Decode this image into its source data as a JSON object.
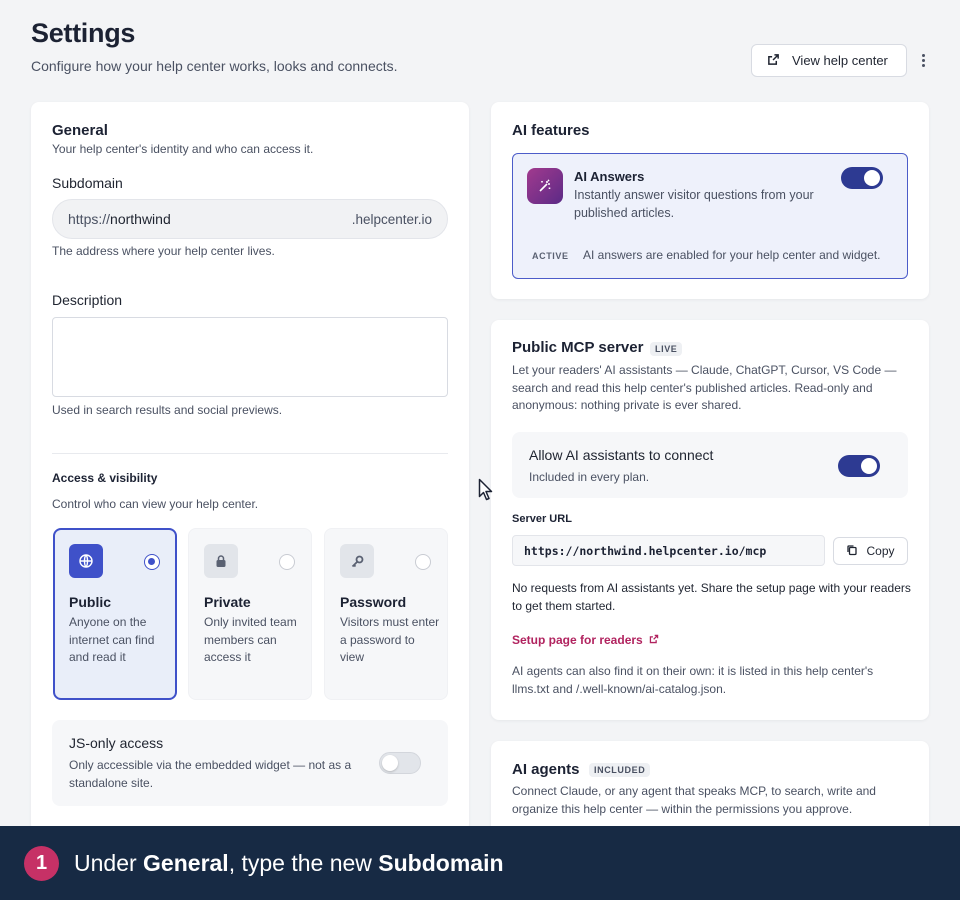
{
  "header": {
    "title": "Settings",
    "subtitle": "Configure how your help center works, looks and connects.",
    "view_button": "View help center",
    "view_icon": "external-link-icon",
    "more_icon": "more-vertical-icon"
  },
  "general": {
    "title": "General",
    "subtitle": "Your help center's identity and who can access it.",
    "subdomain_label": "Subdomain",
    "subdomain_prefix": "https://",
    "subdomain_value": "northwind",
    "subdomain_suffix": ".helpcenter.io",
    "subdomain_help": "The address where your help center lives.",
    "description_label": "Description",
    "description_value": "",
    "description_help": "Used in search results and social previews.",
    "access_title": "Access & visibility",
    "access_subtitle": "Control who can view your help center.",
    "options": [
      {
        "title": "Public",
        "desc": "Anyone on the internet can find and read it",
        "icon": "globe-icon",
        "selected": true
      },
      {
        "title": "Private",
        "desc": "Only invited team members can access it",
        "icon": "lock-icon",
        "selected": false
      },
      {
        "title": "Password",
        "desc": "Visitors must enter a password to view",
        "icon": "key-icon",
        "selected": false
      }
    ],
    "js_title": "JS-only access",
    "js_desc": "Only accessible via the embedded widget — not as a standalone site.",
    "js_enabled": false
  },
  "ai_features": {
    "title": "AI features",
    "answers_title": "AI Answers",
    "answers_desc": "Instantly answer visitor questions from your published articles.",
    "answers_icon": "magic-wand-icon",
    "answers_enabled": true,
    "status_badge": "ACTIVE",
    "status_text": "AI answers are enabled for your help center and widget."
  },
  "mcp": {
    "title": "Public MCP server",
    "badge": "LIVE",
    "desc": "Let your readers' AI assistants — Claude, ChatGPT, Cursor, VS Code — search and read this help center's published articles. Read-only and anonymous: nothing private is ever shared.",
    "allow_title": "Allow AI assistants to connect",
    "allow_sub": "Included in every plan.",
    "allow_enabled": true,
    "url_label": "Server URL",
    "url": "https://northwind.helpcenter.io/mcp",
    "copy_label": "Copy",
    "copy_icon": "copy-icon",
    "no_requests": "No requests from AI assistants yet. Share the setup page with your readers to get them started.",
    "setup_link": "Setup page for readers",
    "discover_text": "AI agents can also find it on their own: it is listed in this help center's llms.txt and /.well-known/ai-catalog.json."
  },
  "agents": {
    "title": "AI agents",
    "badge": "INCLUDED",
    "desc": "Connect Claude, or any agent that speaks MCP, to search, write and organize this help center — within the permissions you approve."
  },
  "footer": {
    "step": "1",
    "text_1": "Under ",
    "text_bold_1": "General",
    "text_2": ", type the new ",
    "text_bold_2": "Subdomain"
  }
}
